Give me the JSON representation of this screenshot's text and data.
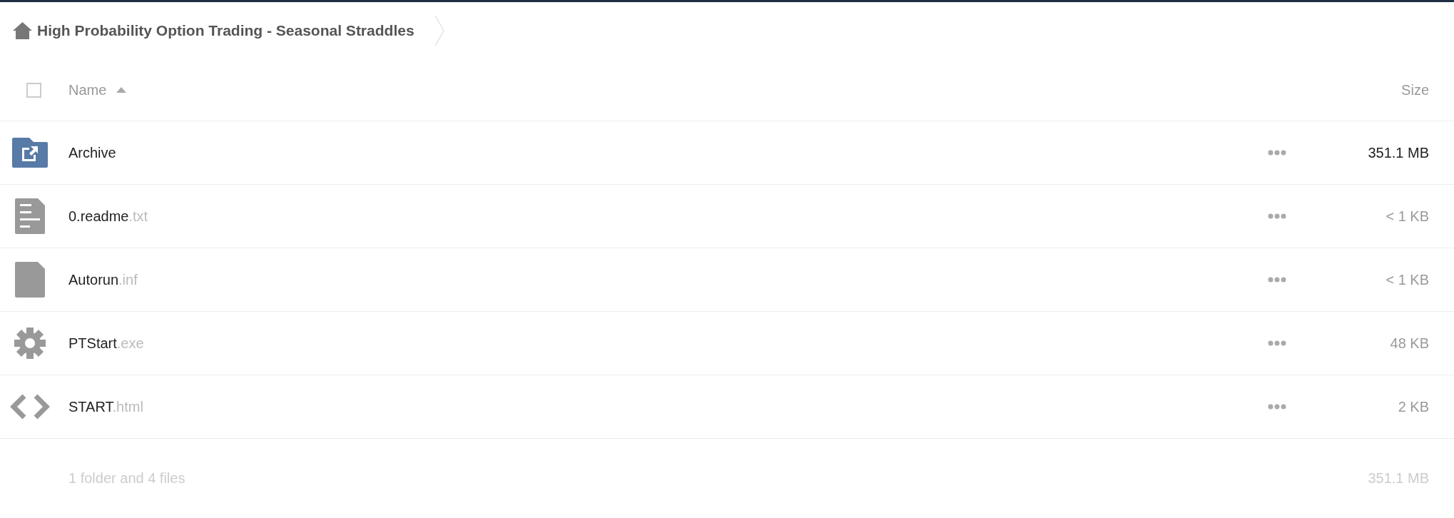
{
  "breadcrumb": {
    "title": "High Probability Option Trading - Seasonal Straddles"
  },
  "table": {
    "select_all": {
      "checked": false
    },
    "columns": [
      {
        "label": "Name",
        "sort_ascending": true
      },
      {
        "label": "Size"
      }
    ],
    "rows": [
      {
        "kind": "shared-folder",
        "name": "Archive",
        "size": "351.1 MB"
      },
      {
        "kind": "text",
        "name": "0.readme",
        "extension": ".txt",
        "size": "< 1 KB"
      },
      {
        "kind": "file",
        "name": "Autorun",
        "extension": ".inf",
        "size": "< 1 KB"
      },
      {
        "kind": "executable",
        "name": "PTStart",
        "extension": ".exe",
        "size": "48 KB"
      },
      {
        "kind": "code",
        "name": "START",
        "extension": ".html",
        "size": "2 KB"
      }
    ]
  },
  "summary": {
    "text": "1 folder and 4 files",
    "size": "351.1 MB"
  }
}
